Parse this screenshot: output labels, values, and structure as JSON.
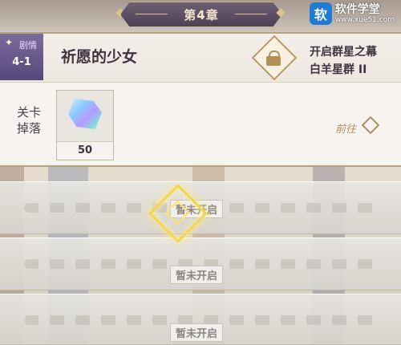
{
  "chapter": {
    "title": "第4章"
  },
  "watermark": {
    "icon": "软",
    "main": "软件学堂",
    "sub": "www.xue51.com"
  },
  "stage": {
    "tag": "剧情",
    "number": "4-1",
    "name": "祈愿的少女",
    "unlock_line1": "开启群星之幕",
    "unlock_line2": "白羊星群 II",
    "drop_label": "关卡掉落",
    "drop_item_icon": "crystal-icon",
    "drop_count": "50",
    "go_label": "前往"
  },
  "locked_rows": [
    {
      "label": "暂未开启"
    },
    {
      "label": "暂未开启"
    },
    {
      "label": "暂未开启"
    }
  ],
  "colors": {
    "accent_gold": "#b09060",
    "badge_purple": "#6b5c8a",
    "chapter_plate": "#5a4c62"
  }
}
